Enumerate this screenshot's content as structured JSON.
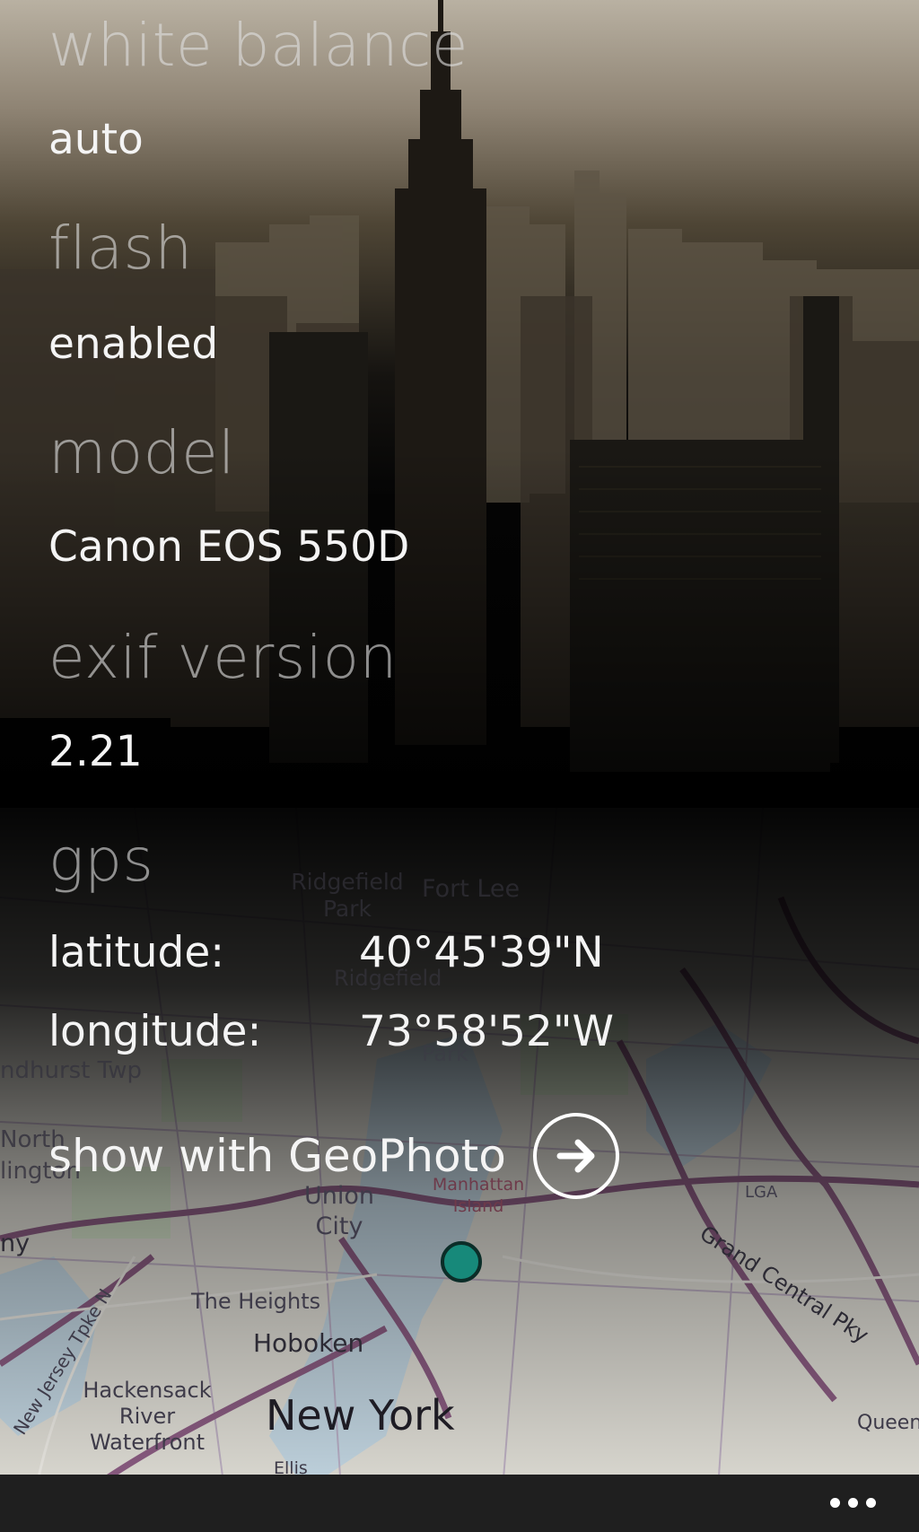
{
  "photo_details": {
    "white_balance": {
      "heading": "white balance",
      "value": "auto"
    },
    "flash": {
      "heading": "flash",
      "value": "enabled"
    },
    "model": {
      "heading": "model",
      "value": "Canon EOS 550D"
    },
    "exif_version": {
      "heading": "exif version",
      "value": "2.21"
    },
    "gps": {
      "heading": "gps",
      "latitude_label": "latitude:",
      "latitude_value": "40°45'39\"N",
      "longitude_label": "longitude:",
      "longitude_value": "73°58'52\"W"
    },
    "geophoto_link": {
      "label": "show with GeoPhoto",
      "icon": "arrow-right-circle-icon"
    }
  },
  "map_labels": {
    "ridgefield_park": "Ridgefield Park",
    "fort_lee": "Fort Lee",
    "ridgefield": "Ridgefield",
    "palisades_park": "Park",
    "lyndhurst": "ndhurst Twp",
    "north_arlington": "North",
    "arlington": "lington",
    "manhattan_island": "Manhattan Island",
    "union_city": "Union City",
    "the_heights": "The Heights",
    "hoboken": "Hoboken",
    "hackensack": "Hackensack River Waterfront",
    "new_york": "New York",
    "grand_central": "Grand Central Pky",
    "queens": "Queen",
    "lga": "LGA",
    "jersey": "ny",
    "ellis": "Ellis",
    "nj_turnpike": "New Jersey Tpke N"
  },
  "app_bar": {
    "more_icon": "ellipsis-icon"
  },
  "colors": {
    "pin": "#17897a",
    "app_bar": "#1f1f1f",
    "text": "#f4f4f4"
  }
}
